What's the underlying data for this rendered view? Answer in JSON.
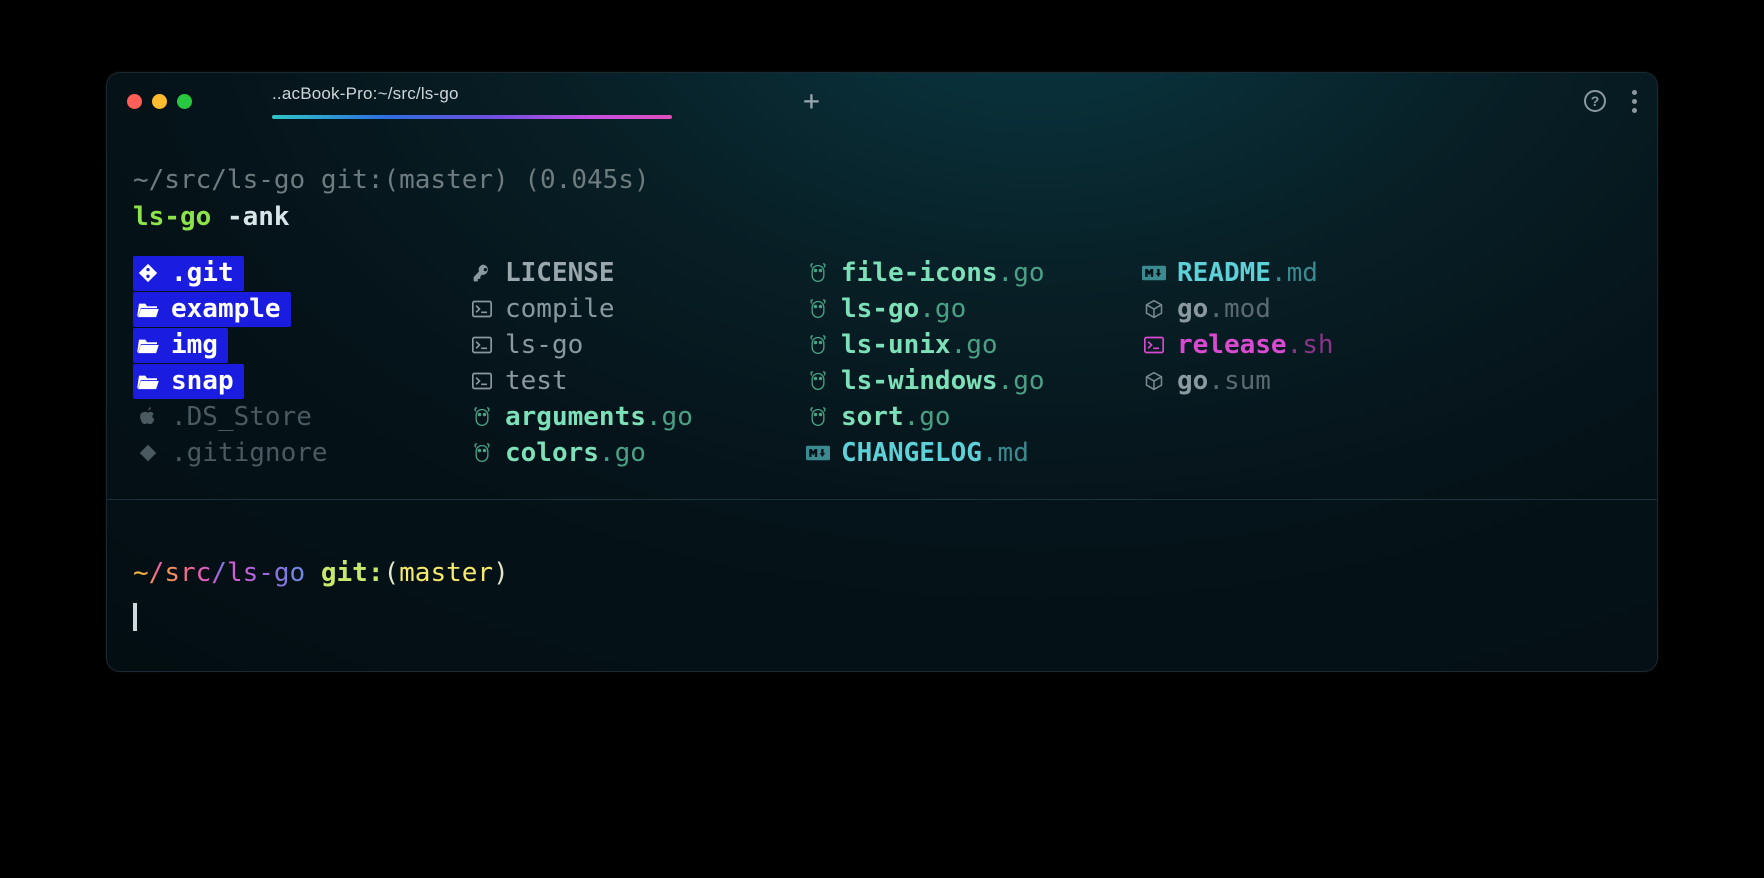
{
  "window": {
    "traffic_lights": {
      "close": "#ff5f57",
      "minimize": "#febc2e",
      "zoom": "#28c840"
    },
    "tab_title": "..acBook-Pro:~/src/ls-go",
    "plus": "+"
  },
  "prompt1": {
    "path": "~/src/ls-go",
    "git_label": "git:",
    "branch": "(master)",
    "timing": "(0.045s)"
  },
  "command": {
    "name": "ls-go",
    "args": "-ank"
  },
  "columns": [
    [
      {
        "icon": "git-icon",
        "style": "dir-badge navy",
        "name": ".git",
        "ext": ""
      },
      {
        "icon": "folder-open-icon",
        "style": "dir-badge navy",
        "name": "example",
        "ext": ""
      },
      {
        "icon": "folder-open-icon",
        "style": "dir-badge navy",
        "name": "img",
        "ext": ""
      },
      {
        "icon": "folder-open-icon",
        "style": "dir-badge navy",
        "name": "snap",
        "ext": ""
      },
      {
        "icon": "apple-icon",
        "style": "dim",
        "name": ".DS_Store",
        "ext": ""
      },
      {
        "icon": "git-diamond-icon",
        "style": "dim",
        "name": ".gitignore",
        "ext": ""
      }
    ],
    [
      {
        "icon": "key-icon",
        "style": "lic",
        "name": "LICENSE",
        "ext": ""
      },
      {
        "icon": "terminal-icon",
        "style": "mid",
        "name": "compile",
        "ext": ""
      },
      {
        "icon": "terminal-icon",
        "style": "mid",
        "name": "ls-go",
        "ext": ""
      },
      {
        "icon": "terminal-icon",
        "style": "mid",
        "name": "test",
        "ext": ""
      },
      {
        "icon": "gopher-icon",
        "style": "go",
        "name": "arguments",
        "ext": ".go"
      },
      {
        "icon": "gopher-icon",
        "style": "go",
        "name": "colors",
        "ext": ".go"
      }
    ],
    [
      {
        "icon": "gopher-icon",
        "style": "go",
        "name": "file-icons",
        "ext": ".go"
      },
      {
        "icon": "gopher-icon",
        "style": "go",
        "name": "ls-go",
        "ext": ".go"
      },
      {
        "icon": "gopher-icon",
        "style": "go",
        "name": "ls-unix",
        "ext": ".go"
      },
      {
        "icon": "gopher-icon",
        "style": "go",
        "name": "ls-windows",
        "ext": ".go"
      },
      {
        "icon": "gopher-icon",
        "style": "go",
        "name": "sort",
        "ext": ".go"
      },
      {
        "icon": "markdown-icon",
        "style": "md",
        "name": "CHANGELOG",
        "ext": ".md"
      }
    ],
    [
      {
        "icon": "markdown-icon",
        "style": "md",
        "name": "README",
        "ext": ".md"
      },
      {
        "icon": "package-icon",
        "style": "mod",
        "name": "go",
        "ext": ".mod"
      },
      {
        "icon": "terminal-icon",
        "style": "sh",
        "name": "release",
        "ext": ".sh"
      },
      {
        "icon": "package-icon",
        "style": "mod",
        "name": "go",
        "ext": ".sum"
      }
    ]
  ],
  "prompt2": {
    "tilde": "~",
    "sep": "/",
    "seg1": "src",
    "seg2": "ls-go",
    "git": "git:",
    "lpar": "(",
    "branch": "master",
    "rpar": ")"
  }
}
